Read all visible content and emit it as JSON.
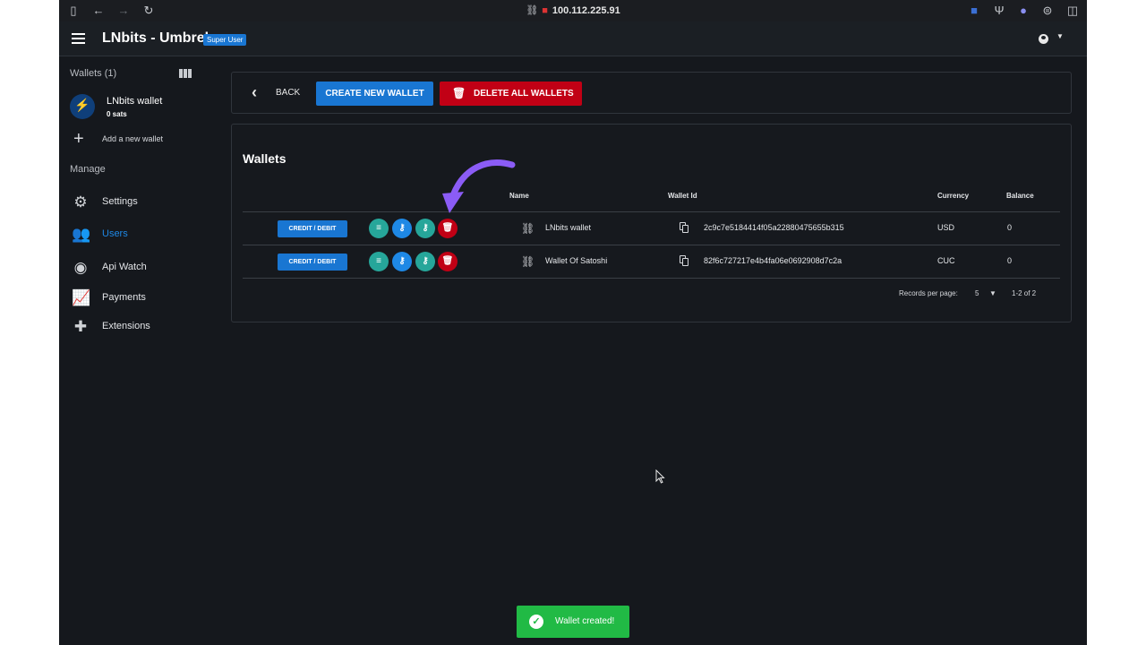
{
  "browser": {
    "url": "100.112.225.91",
    "icons": [
      "sidebar-icon",
      "back-arrow-icon",
      "forward-arrow-icon",
      "reload-icon",
      "link-icon",
      "lock-icon",
      "extension-icon",
      "extension-icon",
      "extension-icon",
      "extension-icon",
      "split-view-icon"
    ]
  },
  "header": {
    "title": "LNbits - Umbrel",
    "badge": "Super User",
    "icons": [
      "menu-icon",
      "account-icon",
      "caret-down-icon"
    ]
  },
  "sidebar": {
    "wallets_title": "Wallets (1)",
    "wallet": {
      "name": "LNbits wallet",
      "balance": "0 sats"
    },
    "add_wallet": "Add a new wallet",
    "manage_title": "Manage",
    "nav": [
      {
        "label": "Settings",
        "icon": "gear-icon",
        "active": false
      },
      {
        "label": "Users",
        "icon": "users-icon",
        "active": true
      },
      {
        "label": "Api Watch",
        "icon": "api-watch-icon",
        "active": false
      },
      {
        "label": "Payments",
        "icon": "payments-chart-icon",
        "active": false
      },
      {
        "label": "Extensions",
        "icon": "puzzle-icon",
        "active": false
      }
    ]
  },
  "toolbar": {
    "back": "BACK",
    "create": "CREATE NEW WALLET",
    "delete_all": "DELETE ALL WALLETS"
  },
  "wallets": {
    "heading": "Wallets",
    "columns": [
      "Name",
      "Wallet Id",
      "Currency",
      "Balance"
    ],
    "credit_debit": "CREDIT / DEBIT",
    "rows": [
      {
        "name": "LNbits wallet",
        "id": "2c9c7e5184414f05a22880475655b315",
        "currency": "USD",
        "balance": "0"
      },
      {
        "name": "Wallet Of Satoshi",
        "id": "82f6c727217e4b4fa06e0692908d7c2a",
        "currency": "CUC",
        "balance": "0"
      }
    ],
    "pager": {
      "label": "Records per page:",
      "value": "5",
      "range": "1-2 of 2"
    }
  },
  "toast": {
    "message": "Wallet created!"
  },
  "colors": {
    "primary": "#1976d2",
    "negative": "#c10015",
    "teal": "#26a69a",
    "positive": "#21ba45",
    "annotation": "#8b5cf6"
  }
}
